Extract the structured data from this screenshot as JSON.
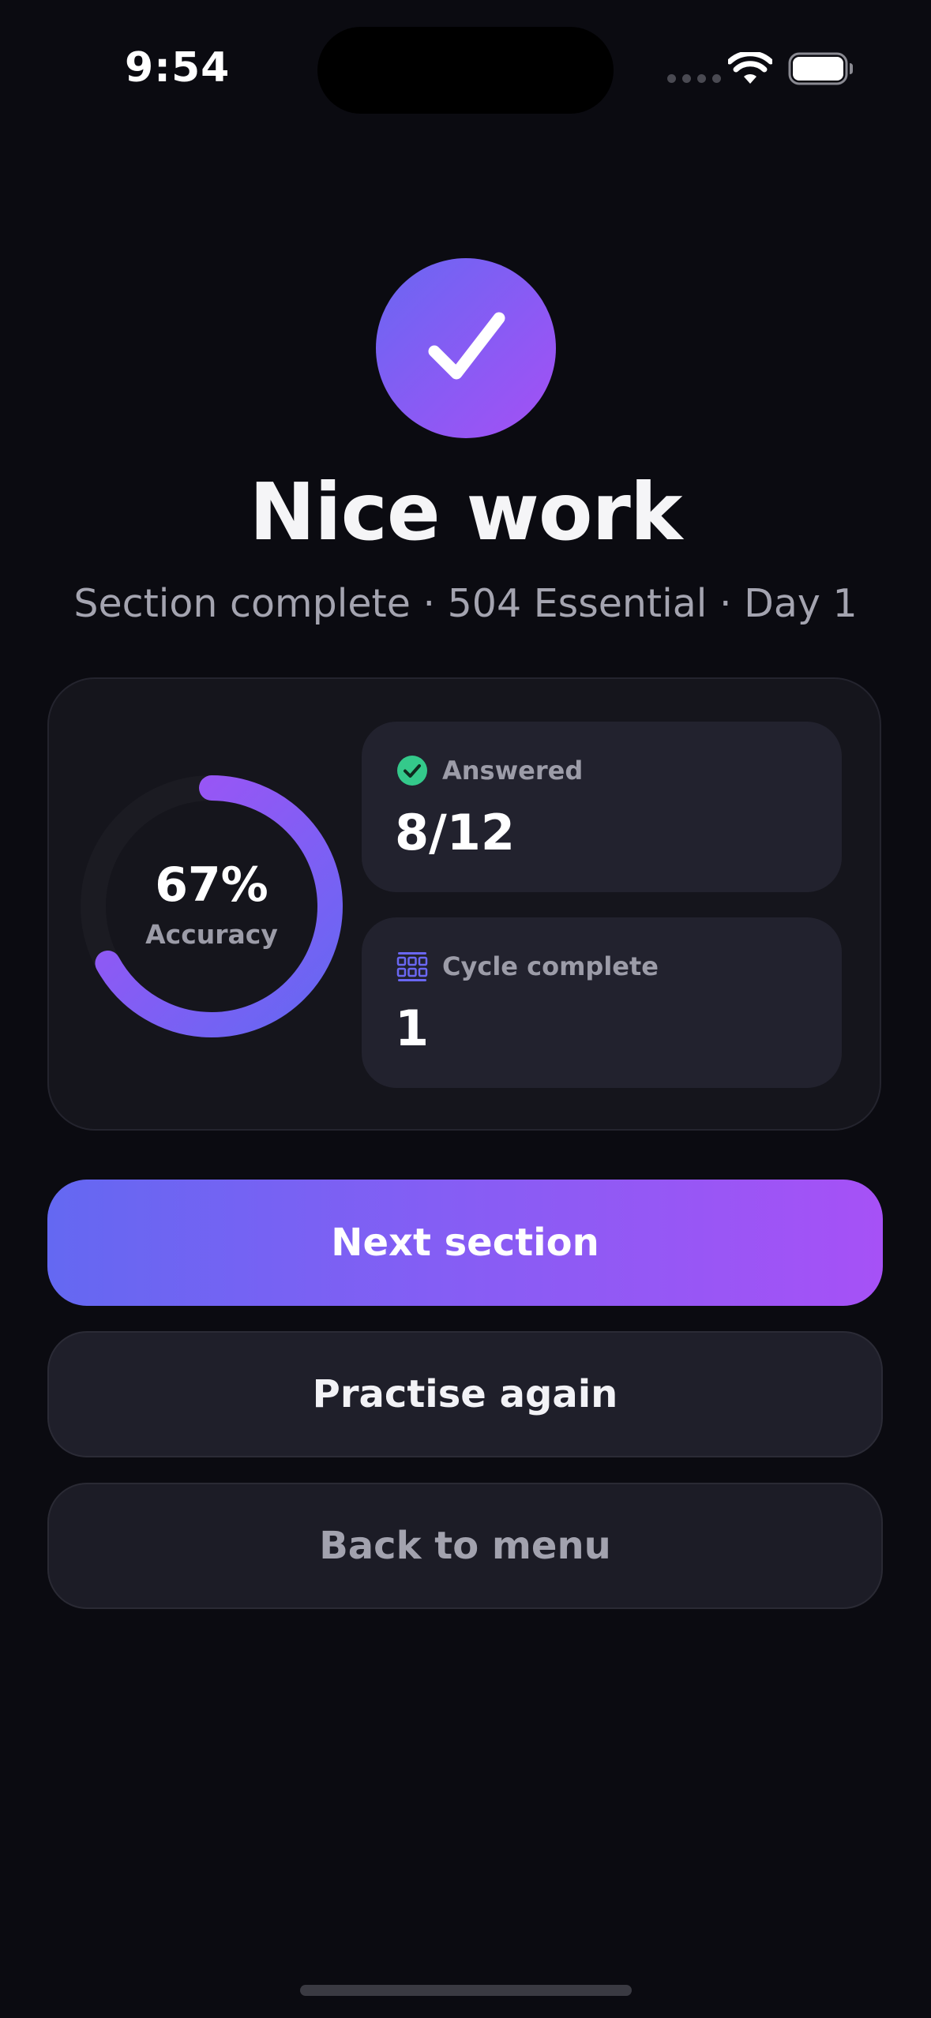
{
  "status_bar": {
    "time": "9:54"
  },
  "hero": {
    "icon": "checkmark-icon",
    "title": "Nice work",
    "subtitle": "Section complete · 504 Essential · Day 1"
  },
  "results": {
    "accuracy": {
      "value": "67%",
      "label": "Accuracy",
      "fraction": 0.67
    },
    "answered": {
      "label": "Answered",
      "value": "8/12",
      "icon": "check-circle-icon"
    },
    "cycle": {
      "label": "Cycle complete",
      "value": "1",
      "icon": "grid-icon"
    }
  },
  "actions": {
    "next_label": "Next section",
    "practise_label": "Practise again",
    "menu_label": "Back to menu"
  },
  "colors": {
    "background": "#0b0b11",
    "accent_start": "#6468f2",
    "accent_end": "#a651f6",
    "success": "#34c98b",
    "card": "#15151c",
    "tile": "#22222e"
  }
}
